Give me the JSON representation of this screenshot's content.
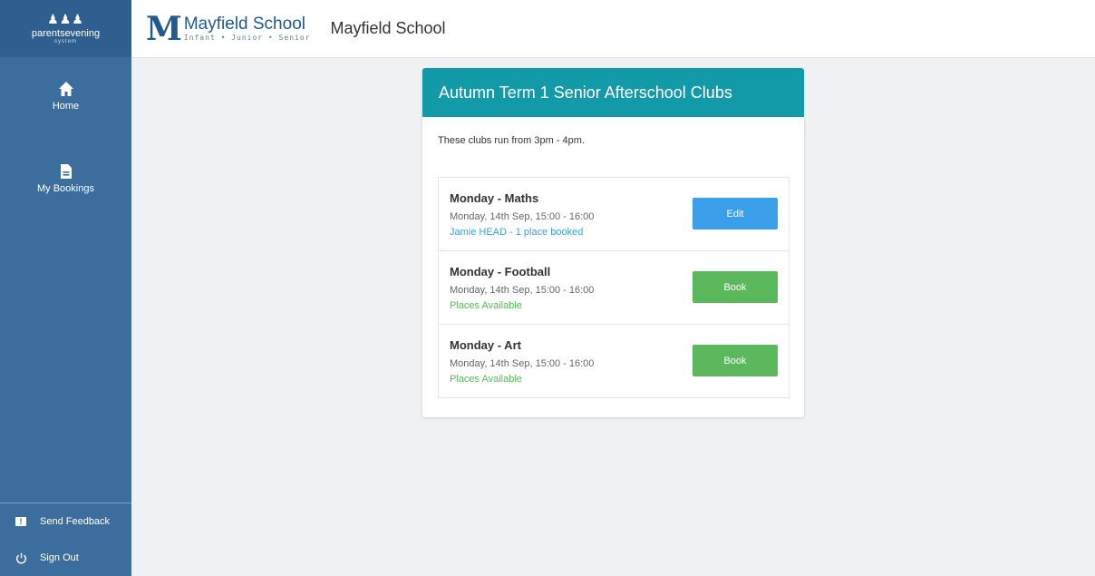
{
  "sidebar": {
    "brand_name": "parentsevening",
    "brand_sub": "system",
    "items": [
      {
        "label": "Home",
        "icon": "home-icon"
      },
      {
        "label": "My Bookings",
        "icon": "document-icon"
      }
    ],
    "bottom": [
      {
        "label": "Send Feedback",
        "icon": "feedback-icon"
      },
      {
        "label": "Sign Out",
        "icon": "power-icon"
      }
    ]
  },
  "header": {
    "logo_title": "Mayfield School",
    "logo_sub": "Infant • Junior • Senior",
    "school_name": "Mayfield School"
  },
  "card": {
    "title": "Autumn Term 1 Senior Afterschool Clubs",
    "intro": "These clubs run from 3pm - 4pm.",
    "clubs": [
      {
        "name": "Monday - Maths",
        "time": "Monday, 14th Sep, 15:00 - 16:00",
        "status": "Jamie HEAD - 1 place booked",
        "action": "Edit"
      },
      {
        "name": "Monday - Football",
        "time": "Monday, 14th Sep, 15:00 - 16:00",
        "status": "Places Available",
        "action": "Book"
      },
      {
        "name": "Monday - Art",
        "time": "Monday, 14th Sep, 15:00 - 16:00",
        "status": "Places Available",
        "action": "Book"
      }
    ]
  },
  "colors": {
    "sidebar": "#3b6e9c",
    "card_header": "#139aa9",
    "edit_button": "#3a9ee9",
    "book_button": "#5cb85c"
  }
}
